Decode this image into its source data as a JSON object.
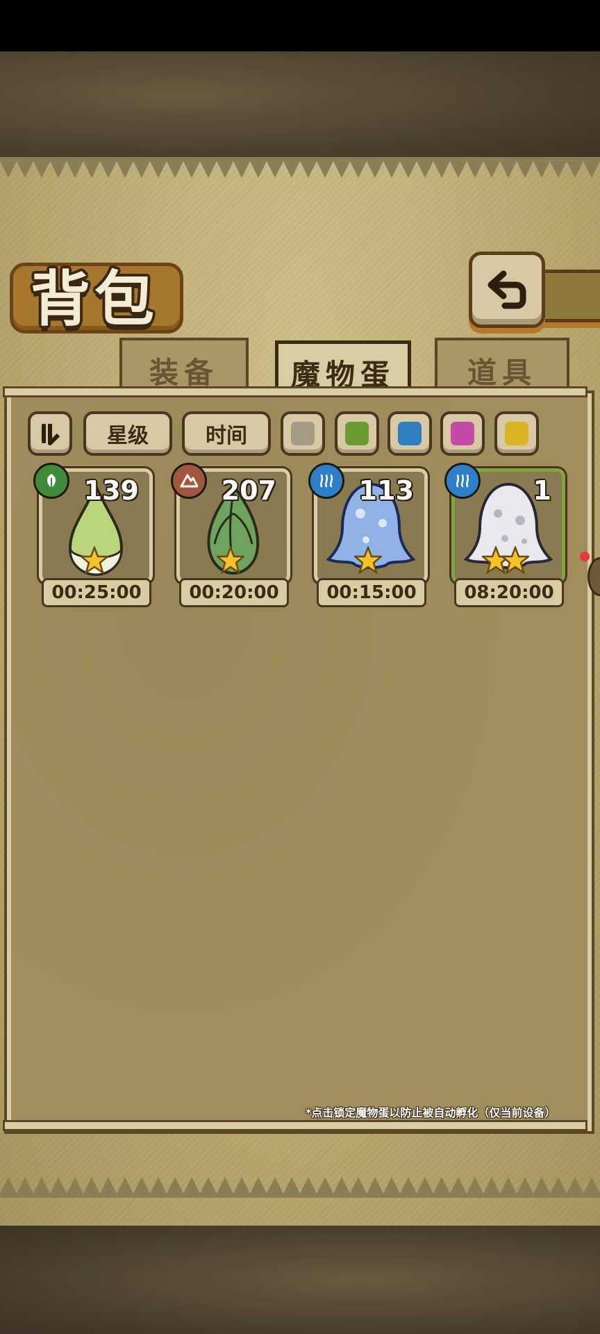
{
  "title": "背包",
  "tabs": [
    {
      "label": "装备",
      "active": false
    },
    {
      "label": "魔物蛋",
      "active": true
    },
    {
      "label": "道具",
      "active": false
    }
  ],
  "toolbar": {
    "sort_icon": "sort-toggle-icon",
    "star_label": "星级",
    "time_label": "时间",
    "color_filters": [
      {
        "name": "gray-filter",
        "color": "#a49a86"
      },
      {
        "name": "green-filter",
        "color": "#6c9a32"
      },
      {
        "name": "blue-filter",
        "color": "#2f7fc0"
      },
      {
        "name": "pink-filter",
        "color": "#c44aa6"
      },
      {
        "name": "yellow-filter",
        "color": "#d9b324"
      }
    ]
  },
  "eggs": [
    {
      "count": "139",
      "time": "00:25:00",
      "element": "leaf-icon",
      "badge_color": "#3d8a3a",
      "stars": 1,
      "body": "#b9d77a"
    },
    {
      "count": "207",
      "time": "00:20:00",
      "element": "mountain-icon",
      "badge_color": "#a2563e",
      "stars": 1,
      "body": "#6da35e"
    },
    {
      "count": "113",
      "time": "00:15:00",
      "element": "steam-icon",
      "badge_color": "#2e7fc8",
      "stars": 1,
      "body": "#8fb3e6"
    },
    {
      "count": "1",
      "time": "08:20:00",
      "element": "steam-icon",
      "badge_color": "#2e7fc8",
      "stars": 2,
      "body": "#e8e8ee"
    }
  ],
  "hint": "*点击锁定魔物蛋以防止被自动孵化（仅当前设备）"
}
